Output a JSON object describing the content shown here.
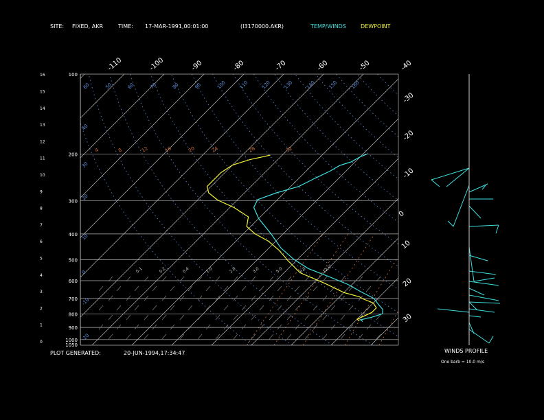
{
  "header": {
    "site_label": "SITE:",
    "site_value": "FIXED, AKR",
    "time_label": "TIME:",
    "time_value": "17-MAR-1991,00:01:00",
    "file_id": "(I3170000.AKR)",
    "legend_temp": "TEMP/WINDS",
    "legend_dew": "DEWPOINT"
  },
  "footer": {
    "plot_label": "PLOT GENERATED:",
    "plot_value": "20-JUN-1994,17:34:47"
  },
  "wind_panel": {
    "title": "WINDS PROFILE",
    "barb_note": "One barb = 10.0 m/s"
  },
  "colors": {
    "temp": "#3ee0e0",
    "dewpoint": "#f2f238",
    "grid": "#b8b8b8",
    "dry_adiabat": "#5f8fdc",
    "mixing_ratio": "#d2703c",
    "wind": "#3ee0e0"
  },
  "chart_data": {
    "type": "line",
    "chart_kind": "skew-T log-P sounding",
    "y_scale": "log",
    "ylim": [
      1050,
      100
    ],
    "pressure_ticks": [
      100,
      200,
      300,
      400,
      500,
      600,
      700,
      800,
      900,
      1000,
      1050
    ],
    "height_ticks": [
      "0",
      "1",
      "2",
      "3",
      "4",
      "5",
      "6",
      "7",
      "8",
      "9",
      "10",
      "11",
      "12",
      "13",
      "14",
      "15",
      "16"
    ],
    "temp_ticks_top": [
      "-110",
      "-100",
      "-90",
      "-80",
      "-70",
      "-60",
      "-50",
      "-40"
    ],
    "temp_ticks_right": [
      "-30",
      "-20",
      "-10",
      "0",
      "10",
      "20",
      "30"
    ],
    "isotherm_labels": [
      -110,
      -100,
      -90,
      -80,
      -70,
      -60,
      -50,
      -40,
      -30,
      -20,
      -10,
      0,
      10,
      20,
      30
    ],
    "dry_adiabat_labels_top": [
      "60",
      "50",
      "60",
      "70",
      "80",
      "90",
      "100",
      "110",
      "120",
      "130",
      "140",
      "150",
      "160"
    ],
    "dry_adiabat_labels_left": [
      "40",
      "30",
      "20",
      "10",
      "0",
      "-10",
      "-20"
    ],
    "mixing_ratio_labels_top": [
      "4",
      "8",
      "12",
      "16",
      "20",
      "24",
      "28",
      "32"
    ],
    "mixing_ratio_labels_mid": [
      "0.1",
      "0.2",
      "0.4",
      "1.0",
      "2.0",
      "3.0",
      "5.0",
      "8.0",
      "12.0"
    ],
    "series": [
      {
        "name": "TEMP/WINDS",
        "points": [
          [
            200,
            -59
          ],
          [
            205,
            -60
          ],
          [
            214,
            -61
          ],
          [
            221,
            -63
          ],
          [
            232,
            -64
          ],
          [
            247,
            -66
          ],
          [
            265,
            -68
          ],
          [
            280,
            -72
          ],
          [
            297,
            -75
          ],
          [
            318,
            -74
          ],
          [
            350,
            -70
          ],
          [
            400,
            -63
          ],
          [
            452,
            -57
          ],
          [
            498,
            -51
          ],
          [
            540,
            -45
          ],
          [
            578,
            -38
          ],
          [
            620,
            -31
          ],
          [
            660,
            -26
          ],
          [
            700,
            -21
          ],
          [
            742,
            -18
          ],
          [
            770,
            -16
          ],
          [
            800,
            -15
          ],
          [
            826,
            -17
          ],
          [
            842,
            -19
          ],
          [
            855,
            -18
          ]
        ]
      },
      {
        "name": "DEWPOINT",
        "points": [
          [
            202,
            -83
          ],
          [
            210,
            -87
          ],
          [
            220,
            -90
          ],
          [
            235,
            -91
          ],
          [
            251,
            -91
          ],
          [
            265,
            -91
          ],
          [
            280,
            -89
          ],
          [
            298,
            -85
          ],
          [
            318,
            -79
          ],
          [
            345,
            -73
          ],
          [
            375,
            -71
          ],
          [
            400,
            -67
          ],
          [
            425,
            -62
          ],
          [
            460,
            -57
          ],
          [
            505,
            -52
          ],
          [
            560,
            -46
          ],
          [
            615,
            -37
          ],
          [
            665,
            -30
          ],
          [
            690,
            -25
          ],
          [
            700,
            -24
          ],
          [
            728,
            -20
          ],
          [
            760,
            -18
          ],
          [
            790,
            -18
          ],
          [
            815,
            -19
          ],
          [
            838,
            -20
          ],
          [
            852,
            -19
          ]
        ]
      }
    ]
  }
}
